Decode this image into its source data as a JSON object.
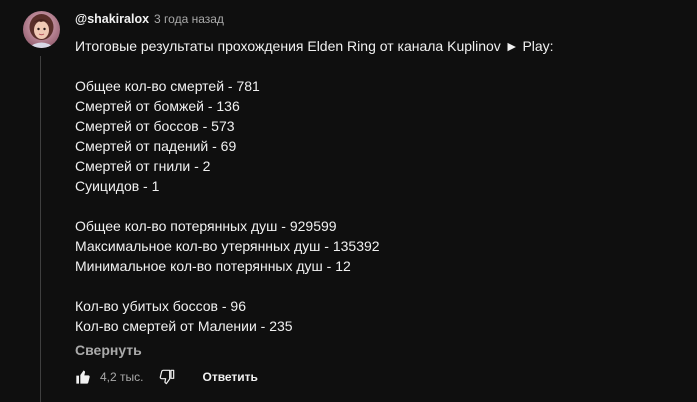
{
  "comment": {
    "author": "@shakiralox",
    "time": "3 года назад",
    "lines": [
      "Итоговые результаты прохождения Elden Ring от канала Kuplinov ► Play:",
      "",
      "Общее кол-во смертей - 781",
      "Смертей от бомжей - 136",
      "Смертей от боссов - 573",
      "Смертей от падений - 69",
      "Смертей от гнили - 2",
      "Суицидов - 1",
      "",
      "Общее кол-во потерянных душ - 929599",
      "Максимальное кол-во утерянных душ - 135392",
      "Минимальное кол-во потерянных душ - 12",
      "",
      "Кол-во убитых боссов - 96",
      "Кол-во смертей от Малении - 235"
    ],
    "collapse_label": "Свернуть"
  },
  "actions": {
    "like_icon": "thumb-up-icon",
    "like_count": "4,2 тыс.",
    "dislike_icon": "thumb-down-icon",
    "reply_label": "Ответить"
  },
  "colors": {
    "background": "#0f0f0f",
    "text": "#f1f1f1",
    "secondary_text": "#aaaaaa"
  }
}
